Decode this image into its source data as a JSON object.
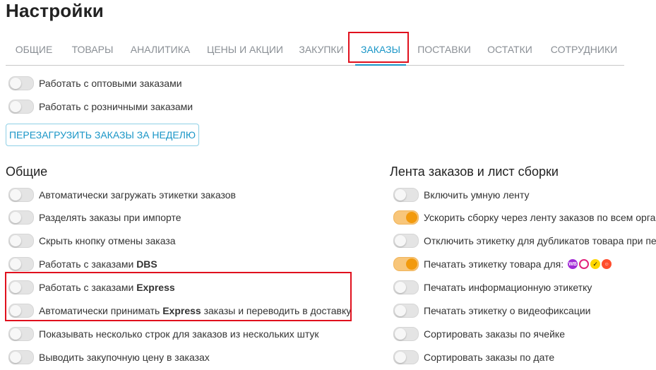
{
  "page": {
    "title": "Настройки"
  },
  "tabs": [
    {
      "label": "ОБЩИЕ"
    },
    {
      "label": "ТОВАРЫ"
    },
    {
      "label": "АНАЛИТИКА"
    },
    {
      "label": "ЦЕНЫ И АКЦИИ"
    },
    {
      "label": "ЗАКУПКИ"
    },
    {
      "label": "ЗАКАЗЫ",
      "active": true
    },
    {
      "label": "ПОСТАВКИ"
    },
    {
      "label": "ОСТАТКИ"
    },
    {
      "label": "СОТРУДНИКИ"
    }
  ],
  "top_toggles": [
    {
      "label": "Работать с оптовыми заказами",
      "on": false
    },
    {
      "label": "Работать с розничными заказами",
      "on": false
    }
  ],
  "reload_button": {
    "label": "ПЕРЕЗАГРУЗИТЬ ЗАКАЗЫ ЗА НЕДЕЛЮ"
  },
  "general": {
    "title": "Общие",
    "items": [
      {
        "label": "Автоматически загружать этикетки заказов",
        "on": false
      },
      {
        "label": "Разделять заказы при импорте",
        "on": false
      },
      {
        "label": "Скрыть кнопку отмены заказа",
        "on": false
      },
      {
        "label": "Работать с заказами ",
        "bold": "DBS",
        "on": false
      },
      {
        "label": "Работать с заказами ",
        "bold": "Express",
        "on": false
      },
      {
        "label": "Автоматически принимать ",
        "bold": "Express",
        "suffix": " заказы и переводить в доставку",
        "on": false
      },
      {
        "label": "Показывать несколько строк для заказов из нескольких штук",
        "on": false
      },
      {
        "label": "Выводить закупочную цену в заказах",
        "on": false
      }
    ]
  },
  "feed": {
    "title": "Лента заказов и лист сборки",
    "items": [
      {
        "label": "Включить умную ленту",
        "on": false
      },
      {
        "label": "Ускорить сборку через ленту заказов по всем орга",
        "on": true
      },
      {
        "label": "Отключить этикетку для дубликатов товара при пе",
        "on": false
      },
      {
        "label": "Печатать этикетку товара  для:",
        "on": true,
        "marketplaces": [
          "wb-icon",
          "ozon-icon",
          "yandex-market-icon",
          "megamarket-icon"
        ]
      },
      {
        "label": "Печатать информационную этикетку",
        "on": false
      },
      {
        "label": "Печатать этикетку о видеофиксации",
        "on": false
      },
      {
        "label": "Сортировать заказы по ячейке",
        "on": false
      },
      {
        "label": "Сортировать заказы по дате",
        "on": false
      }
    ]
  },
  "marketplace_icon_text": {
    "wb": "WB"
  },
  "colors": {
    "accent": "#1a96c7",
    "toggle_on": "#f29a0d",
    "highlight": "#e0101d"
  }
}
